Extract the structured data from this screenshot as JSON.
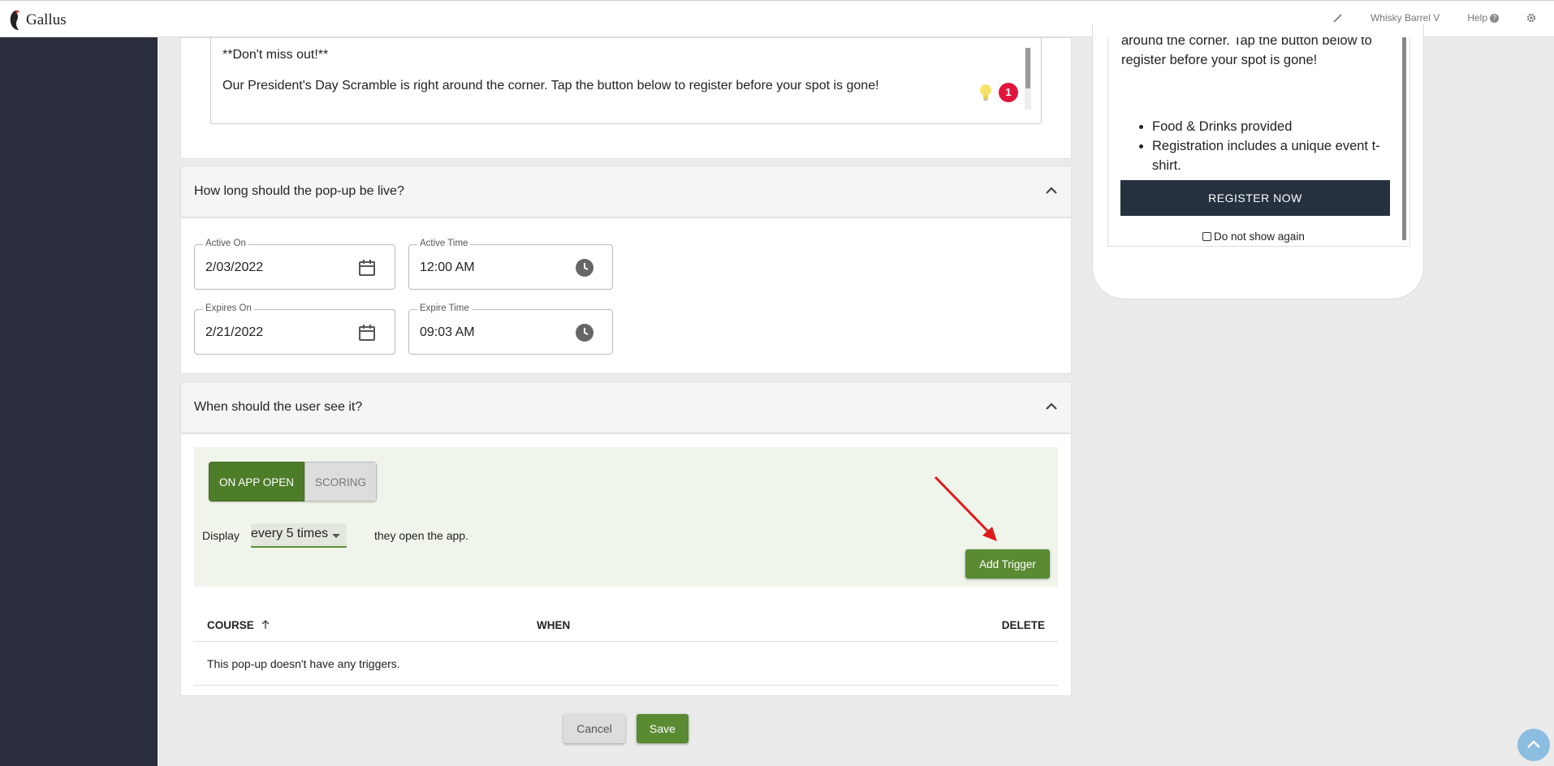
{
  "topbar": {
    "brand": "Gallus",
    "org_name": "Whisky Barrel V",
    "help_label": "Help",
    "help_icon": "?"
  },
  "message": {
    "line1": "**Don't miss out!**",
    "line2": "Our President's Day Scramble is right around the corner. Tap the button below to register before your spot is gone!",
    "suggestion_count": "1"
  },
  "live_section": {
    "title": "How long should the pop-up be live?",
    "active_on_label": "Active On",
    "active_on_value": "2/03/2022",
    "active_time_label": "Active Time",
    "active_time_value": "12:00 AM",
    "expires_on_label": "Expires On",
    "expires_on_value": "2/21/2022",
    "expire_time_label": "Expire Time",
    "expire_time_value": "09:03 AM"
  },
  "trigger_section": {
    "title": "When should the user see it?",
    "mode_on_app_open": "ON APP OPEN",
    "mode_scoring": "SCORING",
    "display_label": "Display",
    "frequency_value": "every 5 times",
    "display_suffix": "they open the app.",
    "add_trigger_label": "Add Trigger",
    "table": {
      "col_course": "COURSE",
      "col_when": "WHEN",
      "col_delete": "DELETE",
      "empty_message": "This pop-up doesn't have any triggers."
    }
  },
  "actions": {
    "cancel_label": "Cancel",
    "save_label": "Save"
  },
  "preview": {
    "body_text": "around the corner. Tap the button below to register before your spot is gone!",
    "bullets": [
      "Food & Drinks provided",
      "Registration includes a unique event t-shirt."
    ],
    "register_label": "REGISTER NOW",
    "dont_show_label": "Do not show again"
  },
  "colors": {
    "sidebar": "#2a2e3d",
    "accent_green": "#5a8a32",
    "badge_red": "#e0163c",
    "register_button": "#26313f"
  }
}
